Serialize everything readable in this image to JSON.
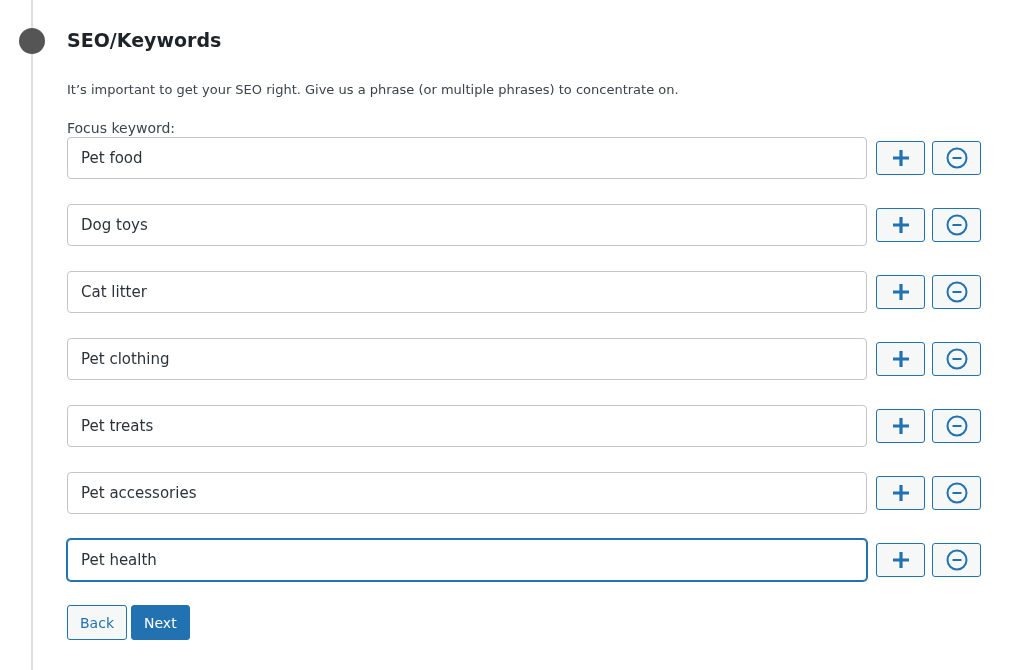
{
  "step": {
    "title": "SEO/Keywords",
    "description": "It’s important to get your SEO right. Give us a phrase (or multiple phrases) to concentrate on."
  },
  "focus_label": "Focus keyword:",
  "keywords": [
    {
      "value": "Pet food",
      "focused": false
    },
    {
      "value": "Dog toys",
      "focused": false
    },
    {
      "value": "Cat litter",
      "focused": false
    },
    {
      "value": "Pet clothing",
      "focused": false
    },
    {
      "value": "Pet treats",
      "focused": false
    },
    {
      "value": "Pet accessories",
      "focused": false
    },
    {
      "value": "Pet health",
      "focused": true
    }
  ],
  "buttons": [
    {
      "label": "Back",
      "kind": "secondary"
    },
    {
      "label": "Next",
      "kind": "primary"
    }
  ]
}
